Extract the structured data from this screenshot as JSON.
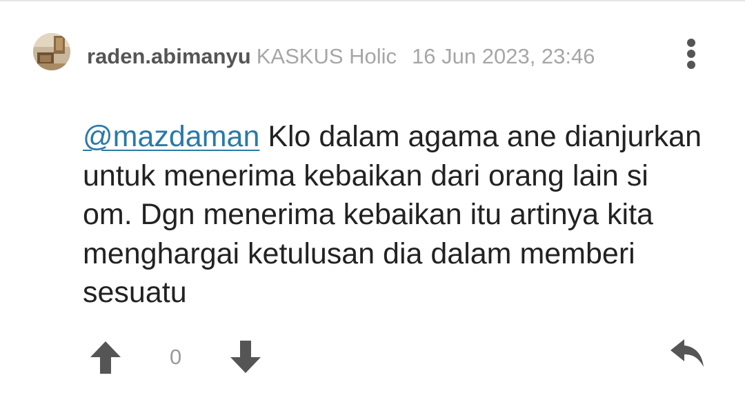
{
  "post": {
    "author": {
      "username": "raden.abimanyu",
      "rank": "KASKUS Holic"
    },
    "timestamp": "16 Jun 2023, 23:46",
    "body": {
      "mention": "@mazdaman",
      "text": " Klo dalam agama ane dianjurkan untuk menerima kebaikan dari orang lain si om. Dgn menerima kebaikan itu artinya kita menghargai ketulusan dia dalam memberi sesuatu"
    },
    "actions": {
      "vote_count": "0"
    }
  },
  "icons": {
    "menu": "vertical-dots-icon",
    "upvote": "arrow-up-icon",
    "downvote": "arrow-down-icon",
    "reply": "reply-icon"
  },
  "colors": {
    "mention": "#2a79a8",
    "username": "#555555",
    "secondary_text": "#a6a6a6",
    "icon": "#555555",
    "body_text": "#222222"
  }
}
